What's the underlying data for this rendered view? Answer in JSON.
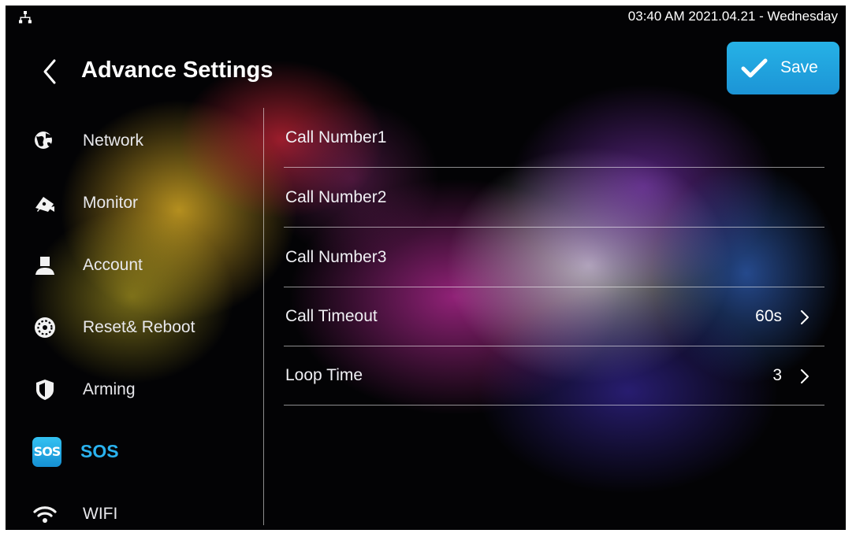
{
  "status_bar": {
    "icons": [
      "network-icon"
    ],
    "datetime": "03:40 AM  2021.04.21 - Wednesday"
  },
  "header": {
    "back_icon": "chevron-left-icon",
    "title": "Advance Settings",
    "save_label": "Save",
    "save_icon": "checkmark-icon",
    "accent_color": "#1fa3e0"
  },
  "sidebar": {
    "items": [
      {
        "label": "Network",
        "icon": "globe-icon",
        "active": false
      },
      {
        "label": "Monitor",
        "icon": "camera-icon",
        "active": false
      },
      {
        "label": "Account",
        "icon": "person-icon",
        "active": false
      },
      {
        "label": "Reset& Reboot",
        "icon": "reset-icon",
        "active": false
      },
      {
        "label": "Arming",
        "icon": "shield-icon",
        "active": false
      },
      {
        "label": "SOS",
        "icon": "sos-icon",
        "badge": "SOS",
        "active": true
      },
      {
        "label": "WIFI",
        "icon": "wifi-icon",
        "active": false
      }
    ],
    "active_color": "#2ab2ef"
  },
  "settings": {
    "rows": [
      {
        "label": "Call Number1",
        "value": ""
      },
      {
        "label": "Call Number2",
        "value": ""
      },
      {
        "label": "Call Number3",
        "value": ""
      },
      {
        "label": "Call Timeout",
        "value": "60s",
        "chevron": "chevron-right-icon"
      },
      {
        "label": "Loop Time",
        "value": "3",
        "chevron": "chevron-right-icon"
      }
    ]
  }
}
